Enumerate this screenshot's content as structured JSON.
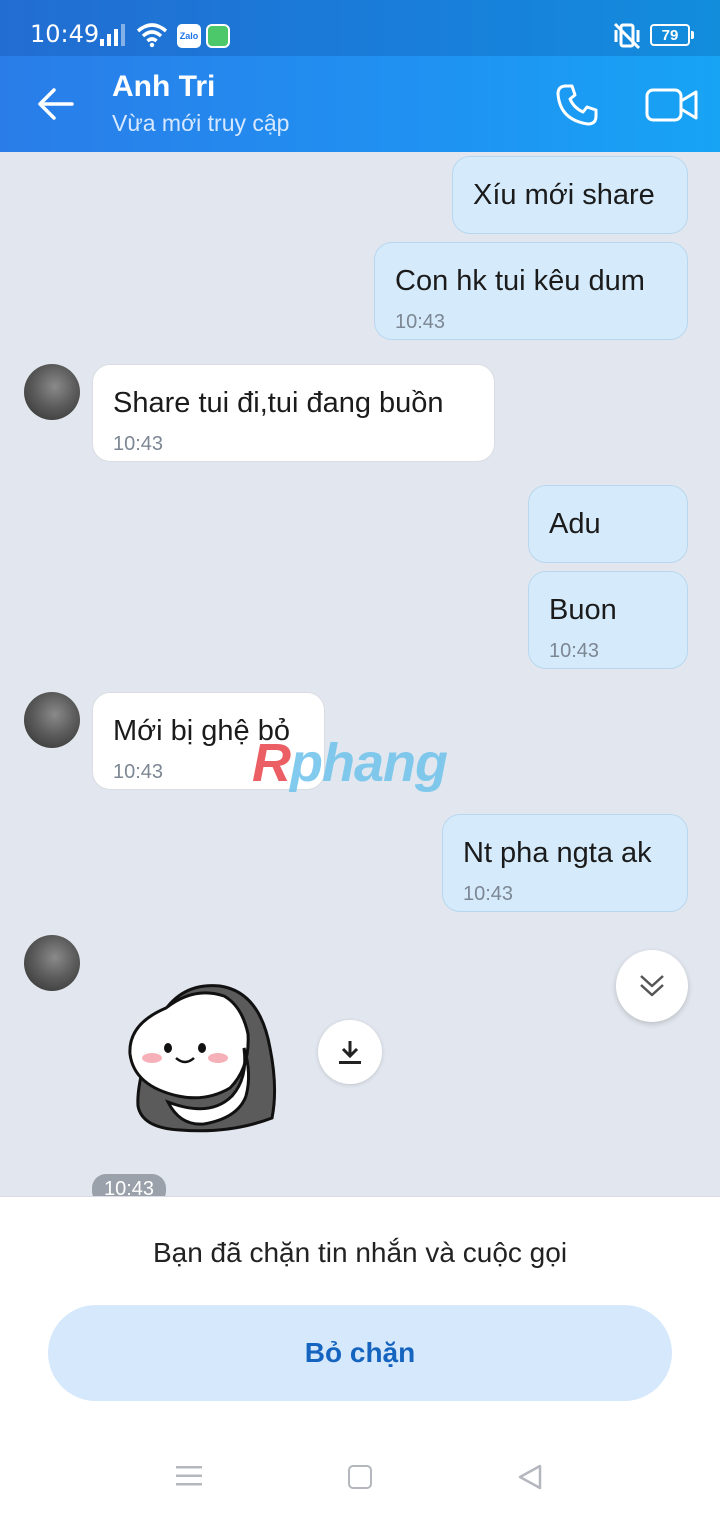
{
  "status_bar": {
    "time": "10:49",
    "zalo_label": "Zalo",
    "battery": "79",
    "icons": [
      "signal-icon",
      "wifi-icon",
      "zalo-app-icon",
      "app-notification-icon",
      "vibrate-mute-icon",
      "battery-icon"
    ]
  },
  "header": {
    "contact_name": "Anh Tri",
    "presence": "Vừa mới truy cập",
    "icons": [
      "back-arrow-icon",
      "phone-icon",
      "video-camera-icon"
    ]
  },
  "messages": [
    {
      "sender": "me",
      "text": "Xíu mới share",
      "time": ""
    },
    {
      "sender": "me",
      "text": "Con hk tui kêu dum",
      "time": "10:43"
    },
    {
      "sender": "them",
      "text": "Share tui đi,tui đang buồn",
      "time": "10:43"
    },
    {
      "sender": "me",
      "text": "Adu",
      "time": ""
    },
    {
      "sender": "me",
      "text": "Buon",
      "time": "10:43"
    },
    {
      "sender": "them",
      "text": "Mới bị ghệ bỏ",
      "time": "10:43"
    },
    {
      "sender": "me",
      "text": "Nt pha ngta ak",
      "time": "10:43"
    },
    {
      "sender": "them",
      "text": "",
      "sticker": "blanket-sticker",
      "time": "10:43"
    }
  ],
  "watermark": {
    "first": "R",
    "rest": "phang"
  },
  "footer": {
    "blocked_notice": "Bạn đã chặn tin nhắn và cuộc gọi",
    "unblock_label": "Bỏ chặn"
  },
  "colors": {
    "header_start": "#2a7de8",
    "header_end": "#17a4f5",
    "my_bubble": "#d5ebfb",
    "their_bubble": "#ffffff",
    "chat_background": "#e2e7ef",
    "unblock_button": "#d6e8fb",
    "unblock_text": "#1565c0"
  }
}
